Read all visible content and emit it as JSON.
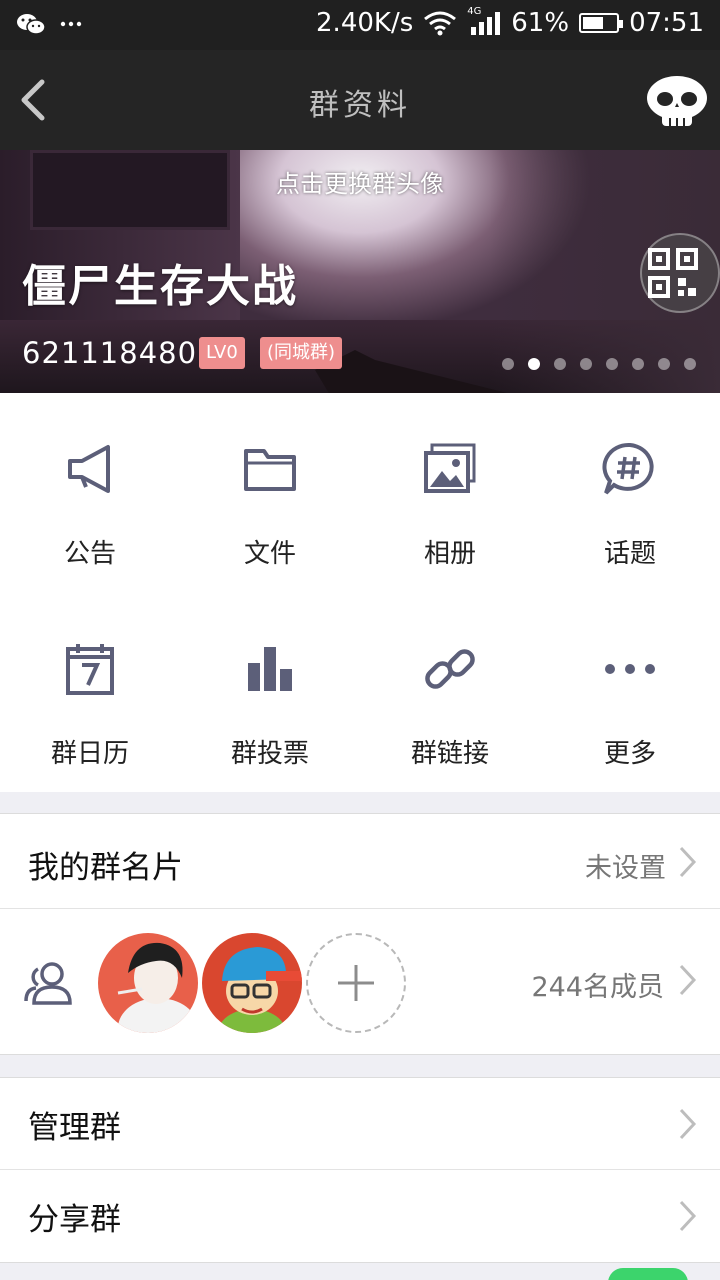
{
  "status_bar": {
    "network_speed": "2.40K/s",
    "network_type": "4G",
    "battery_percent": "61%",
    "battery_level": 0.61,
    "time": "07:51",
    "left_icons": [
      "wechat-icon",
      "more-dots-icon"
    ]
  },
  "header": {
    "title": "群资料",
    "back_icon": "back-arrow-icon",
    "right_icon": "skull-avatar-icon"
  },
  "banner": {
    "hint": "点击更换群头像",
    "group_name": "僵尸生存大战",
    "group_id": "621118480",
    "level_badge": "LV0",
    "city_badge": "(同城群)",
    "page_count": 8,
    "active_page": 2,
    "qr_icon": "qr-code-icon"
  },
  "features": [
    {
      "label": "公告",
      "icon": "megaphone-icon"
    },
    {
      "label": "文件",
      "icon": "folder-icon"
    },
    {
      "label": "相册",
      "icon": "photo-album-icon"
    },
    {
      "label": "话题",
      "icon": "topic-hash-icon"
    },
    {
      "label": "群日历",
      "icon": "calendar-icon"
    },
    {
      "label": "群投票",
      "icon": "bar-chart-icon"
    },
    {
      "label": "群链接",
      "icon": "link-icon"
    },
    {
      "label": "更多",
      "icon": "more-dots-icon"
    }
  ],
  "group_card": {
    "label": "我的群名片",
    "value": "未设置"
  },
  "members": {
    "count": "244名成员",
    "icon": "members-icon",
    "add_icon": "plus-icon"
  },
  "manage": {
    "manage_label": "管理群",
    "share_label": "分享群"
  },
  "colors": {
    "status_bar_bg": "#202020",
    "title_bar_bg": "#252525",
    "icon_color": "#5c5f79",
    "badge_color": "#ee8e8e",
    "page_bg": "#efeff4"
  }
}
